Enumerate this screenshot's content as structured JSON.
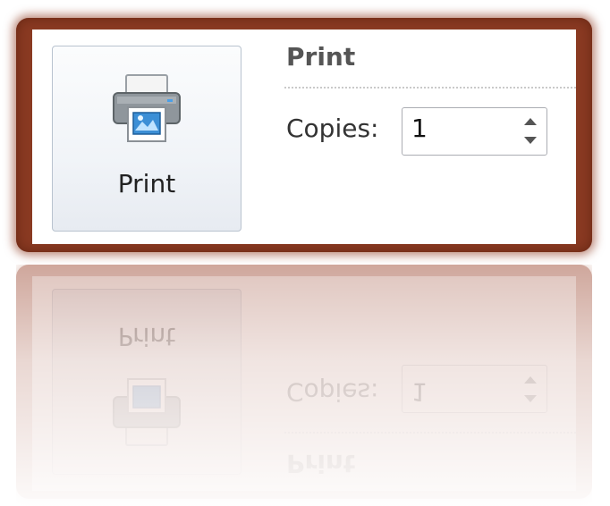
{
  "print_button": {
    "label": "Print",
    "icon": "printer-icon"
  },
  "section": {
    "title": "Print"
  },
  "copies": {
    "label": "Copies:",
    "value": "1"
  },
  "colors": {
    "frame": "#8a3a22",
    "button_border": "#b9c3cf",
    "title_text": "#555555"
  }
}
